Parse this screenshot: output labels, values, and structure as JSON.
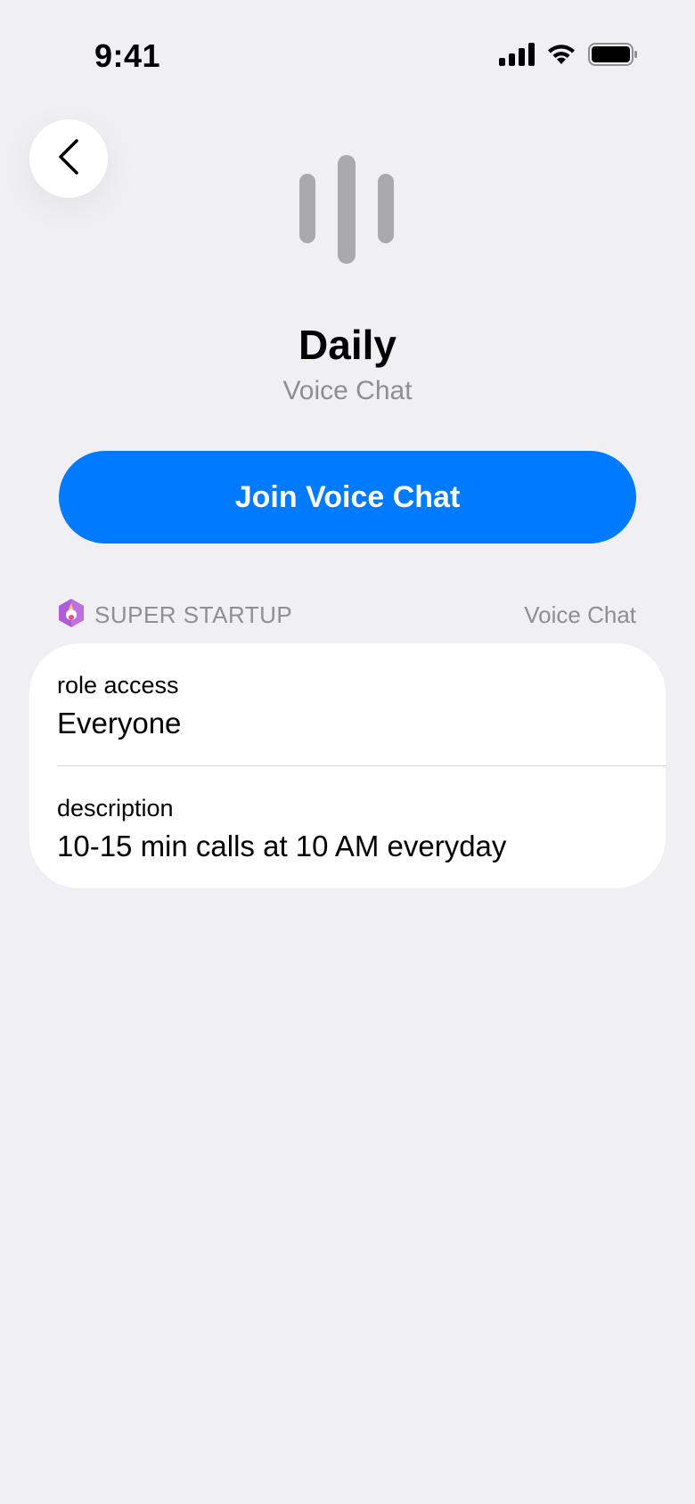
{
  "status_bar": {
    "time": "9:41",
    "icons": [
      "cellular-signal-icon",
      "wifi-icon",
      "battery-icon"
    ]
  },
  "navigation": {
    "back_icon": "chevron-left-icon"
  },
  "channel": {
    "icon": "voice-channel-icon",
    "title": "Daily",
    "subtitle": "Voice Chat"
  },
  "actions": {
    "join_label": "Join Voice Chat"
  },
  "section": {
    "server_icon": "unicorn-server-icon",
    "server_name": "SUPER STARTUP",
    "channel_type": "Voice Chat"
  },
  "details": {
    "rows": [
      {
        "label": "role access",
        "value": "Everyone"
      },
      {
        "label": "description",
        "value": "10-15 min calls at 10 AM everyday"
      }
    ]
  },
  "colors": {
    "background": "#EFEFF4",
    "accent": "#007AFF",
    "secondary_text": "#8E8E93",
    "card": "#FFFFFF",
    "server_badge": "#B05CD6"
  }
}
